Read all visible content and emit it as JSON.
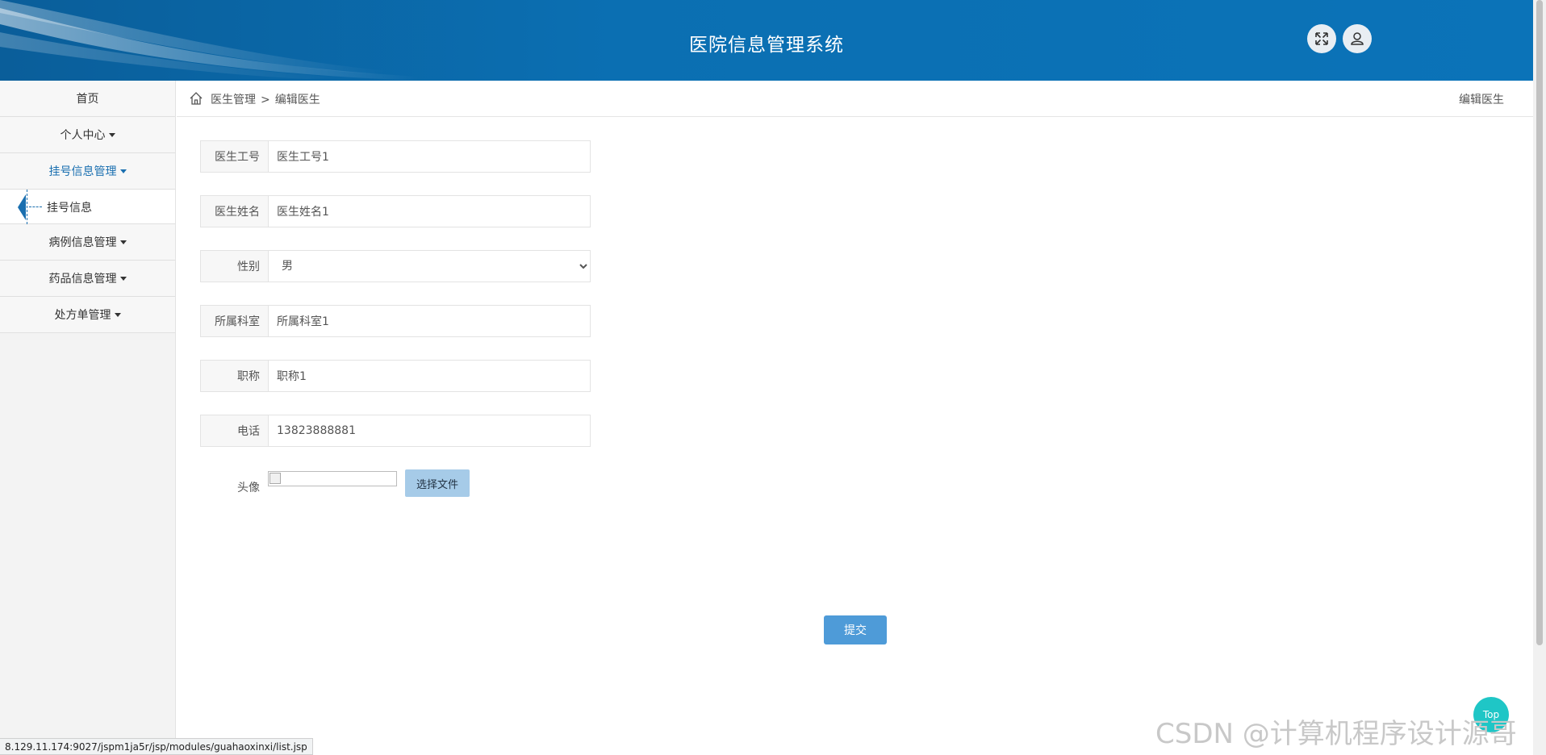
{
  "header": {
    "title": "医院信息管理系统",
    "fullscreen_icon": "expand-arrows-icon",
    "user_icon": "user-icon"
  },
  "sidebar": {
    "items": [
      {
        "label": "首页",
        "has_caret": false
      },
      {
        "label": "个人中心",
        "has_caret": true
      },
      {
        "label": "挂号信息管理",
        "has_caret": true,
        "active": true
      },
      {
        "label": "挂号信息",
        "submenu": true
      },
      {
        "label": "病例信息管理",
        "has_caret": true
      },
      {
        "label": "药品信息管理",
        "has_caret": true
      },
      {
        "label": "处方单管理",
        "has_caret": true
      }
    ]
  },
  "breadcrumb": {
    "section": "医生管理",
    "separator": ">",
    "current": "编辑医生",
    "right_title": "编辑医生"
  },
  "form": {
    "fields": [
      {
        "label": "医生工号",
        "value": "医生工号1"
      },
      {
        "label": "医生姓名",
        "value": "医生姓名1"
      },
      {
        "label": "性别",
        "value": "男",
        "type": "select"
      },
      {
        "label": "所属科室",
        "value": "所属科室1"
      },
      {
        "label": "职称",
        "value": "职称1"
      },
      {
        "label": "电话",
        "value": "13823888881"
      }
    ],
    "avatar_label": "头像",
    "file_button": "选择文件",
    "submit": "提交"
  },
  "top_button": "Top",
  "watermark": "CSDN @计算机程序设计源哥",
  "status_url": "8.129.11.174:9027/jspm1ja5r/jsp/modules/guahaoxinxi/list.jsp",
  "colors": {
    "header": "#0b6fb2",
    "accent": "#1a6fb0",
    "submit": "#4e9bd8",
    "top_button": "#1fc6c6"
  }
}
